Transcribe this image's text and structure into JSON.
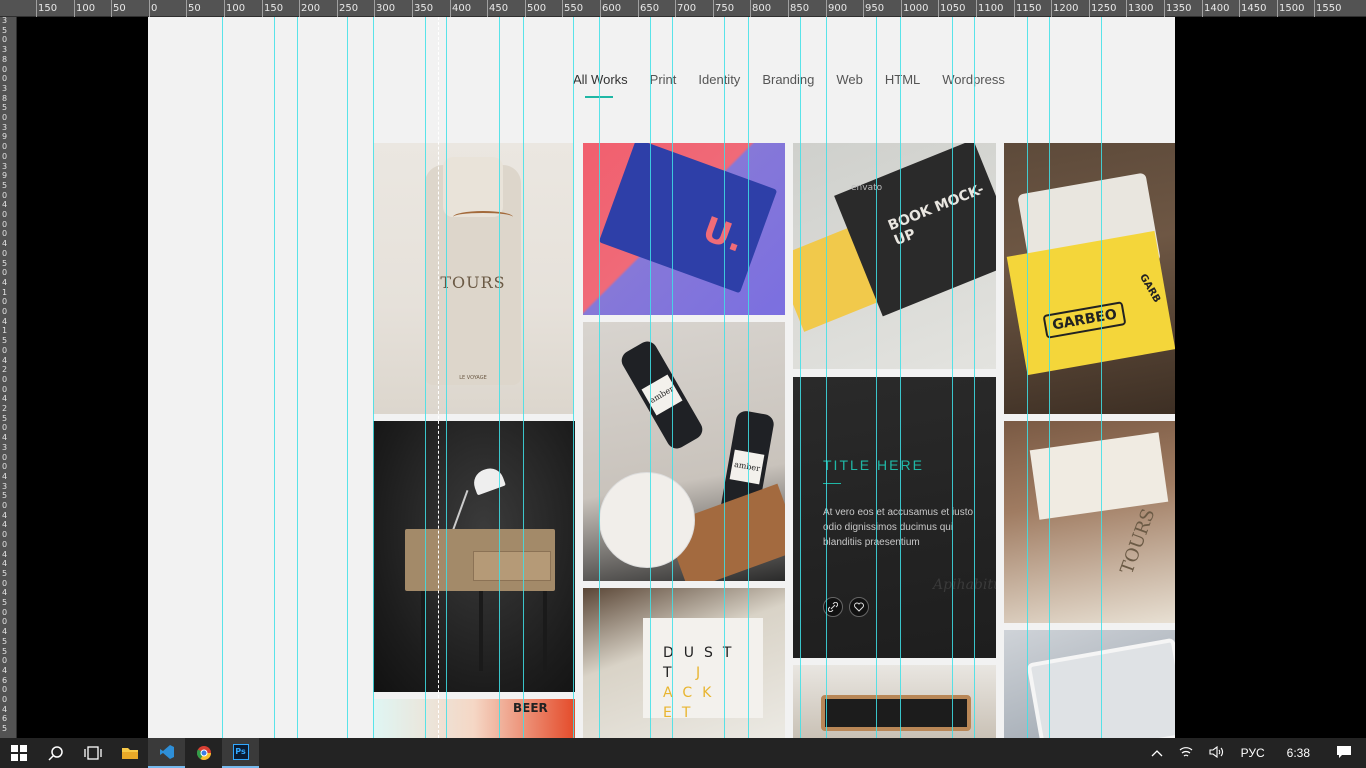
{
  "ruler": {
    "top_labels": [
      "150",
      "100",
      "50",
      "0",
      "50",
      "100",
      "150",
      "200",
      "250",
      "300",
      "350",
      "400",
      "450",
      "500",
      "550",
      "600",
      "650",
      "700",
      "750",
      "800",
      "850",
      "900",
      "950",
      "1000",
      "1050",
      "1100",
      "1150",
      "1200",
      "1250",
      "1300",
      "1350",
      "1400",
      "1450",
      "1500",
      "1550"
    ],
    "left_labels": [
      "3",
      "5",
      "0",
      "3",
      "8",
      "0",
      "0",
      "3",
      "8",
      "5",
      "0",
      "3",
      "9",
      "0",
      "0",
      "3",
      "9",
      "5",
      "0",
      "4",
      "0",
      "0",
      "0",
      "4",
      "0",
      "5",
      "0",
      "4",
      "1",
      "0",
      "0",
      "4",
      "1",
      "5",
      "0",
      "4",
      "2",
      "0",
      "0",
      "4",
      "2",
      "5",
      "0",
      "4",
      "3",
      "0",
      "0",
      "4",
      "3",
      "5",
      "0",
      "4",
      "4",
      "0",
      "0",
      "4",
      "4",
      "5",
      "0",
      "4",
      "5",
      "0",
      "0",
      "4",
      "5",
      "5",
      "0",
      "4",
      "6",
      "0",
      "0",
      "4",
      "6",
      "5"
    ]
  },
  "nav": {
    "items": [
      "All Works",
      "Print",
      "Identity",
      "Branding",
      "Web",
      "HTML",
      "Wordpress"
    ],
    "active_index": 0,
    "accent_color": "#1fb7a5"
  },
  "tiles": {
    "bag": {
      "brand": "TOURS",
      "sub": "LE VOYAGE"
    },
    "book": {
      "letter": "U."
    },
    "mockup": {
      "brand": "envato",
      "text": "BOOK MOCK-UP"
    },
    "garbeo": {
      "label": "GARBEO",
      "side_label": "GARB"
    },
    "bottles": {
      "label1": "amber",
      "label2": "amber"
    },
    "overlay": {
      "title": "TITLE HERE",
      "text": "At vero eos et accusamus et iusto odio dignissimos ducimus qui blanditiis praesentium",
      "link_icon": "link-icon",
      "heart_icon": "heart-icon",
      "signature": "Apihabitus"
    },
    "tours2": {
      "brand": "TOURS"
    },
    "jacket": {
      "line1": "DUST",
      "line2a": "T",
      "line2b": "J",
      "line3": "ACK",
      "line4": "ET"
    },
    "beer": {
      "text": "BEER"
    }
  },
  "taskbar": {
    "items": [
      "start-icon",
      "search-icon",
      "task-view-icon",
      "file-explorer-icon",
      "vscode-icon",
      "chrome-icon",
      "photoshop-icon"
    ],
    "language": "РУС",
    "time": "6:38"
  }
}
